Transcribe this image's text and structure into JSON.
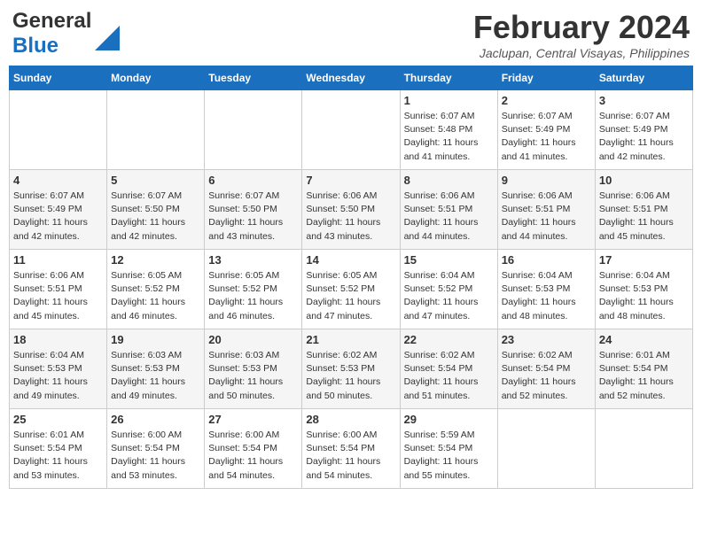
{
  "header": {
    "logo_general": "General",
    "logo_blue": "Blue",
    "month": "February 2024",
    "location": "Jaclupan, Central Visayas, Philippines"
  },
  "weekdays": [
    "Sunday",
    "Monday",
    "Tuesday",
    "Wednesday",
    "Thursday",
    "Friday",
    "Saturday"
  ],
  "weeks": [
    [
      {
        "day": "",
        "info": ""
      },
      {
        "day": "",
        "info": ""
      },
      {
        "day": "",
        "info": ""
      },
      {
        "day": "",
        "info": ""
      },
      {
        "day": "1",
        "info": "Sunrise: 6:07 AM\nSunset: 5:48 PM\nDaylight: 11 hours\nand 41 minutes."
      },
      {
        "day": "2",
        "info": "Sunrise: 6:07 AM\nSunset: 5:49 PM\nDaylight: 11 hours\nand 41 minutes."
      },
      {
        "day": "3",
        "info": "Sunrise: 6:07 AM\nSunset: 5:49 PM\nDaylight: 11 hours\nand 42 minutes."
      }
    ],
    [
      {
        "day": "4",
        "info": "Sunrise: 6:07 AM\nSunset: 5:49 PM\nDaylight: 11 hours\nand 42 minutes."
      },
      {
        "day": "5",
        "info": "Sunrise: 6:07 AM\nSunset: 5:50 PM\nDaylight: 11 hours\nand 42 minutes."
      },
      {
        "day": "6",
        "info": "Sunrise: 6:07 AM\nSunset: 5:50 PM\nDaylight: 11 hours\nand 43 minutes."
      },
      {
        "day": "7",
        "info": "Sunrise: 6:06 AM\nSunset: 5:50 PM\nDaylight: 11 hours\nand 43 minutes."
      },
      {
        "day": "8",
        "info": "Sunrise: 6:06 AM\nSunset: 5:51 PM\nDaylight: 11 hours\nand 44 minutes."
      },
      {
        "day": "9",
        "info": "Sunrise: 6:06 AM\nSunset: 5:51 PM\nDaylight: 11 hours\nand 44 minutes."
      },
      {
        "day": "10",
        "info": "Sunrise: 6:06 AM\nSunset: 5:51 PM\nDaylight: 11 hours\nand 45 minutes."
      }
    ],
    [
      {
        "day": "11",
        "info": "Sunrise: 6:06 AM\nSunset: 5:51 PM\nDaylight: 11 hours\nand 45 minutes."
      },
      {
        "day": "12",
        "info": "Sunrise: 6:05 AM\nSunset: 5:52 PM\nDaylight: 11 hours\nand 46 minutes."
      },
      {
        "day": "13",
        "info": "Sunrise: 6:05 AM\nSunset: 5:52 PM\nDaylight: 11 hours\nand 46 minutes."
      },
      {
        "day": "14",
        "info": "Sunrise: 6:05 AM\nSunset: 5:52 PM\nDaylight: 11 hours\nand 47 minutes."
      },
      {
        "day": "15",
        "info": "Sunrise: 6:04 AM\nSunset: 5:52 PM\nDaylight: 11 hours\nand 47 minutes."
      },
      {
        "day": "16",
        "info": "Sunrise: 6:04 AM\nSunset: 5:53 PM\nDaylight: 11 hours\nand 48 minutes."
      },
      {
        "day": "17",
        "info": "Sunrise: 6:04 AM\nSunset: 5:53 PM\nDaylight: 11 hours\nand 48 minutes."
      }
    ],
    [
      {
        "day": "18",
        "info": "Sunrise: 6:04 AM\nSunset: 5:53 PM\nDaylight: 11 hours\nand 49 minutes."
      },
      {
        "day": "19",
        "info": "Sunrise: 6:03 AM\nSunset: 5:53 PM\nDaylight: 11 hours\nand 49 minutes."
      },
      {
        "day": "20",
        "info": "Sunrise: 6:03 AM\nSunset: 5:53 PM\nDaylight: 11 hours\nand 50 minutes."
      },
      {
        "day": "21",
        "info": "Sunrise: 6:02 AM\nSunset: 5:53 PM\nDaylight: 11 hours\nand 50 minutes."
      },
      {
        "day": "22",
        "info": "Sunrise: 6:02 AM\nSunset: 5:54 PM\nDaylight: 11 hours\nand 51 minutes."
      },
      {
        "day": "23",
        "info": "Sunrise: 6:02 AM\nSunset: 5:54 PM\nDaylight: 11 hours\nand 52 minutes."
      },
      {
        "day": "24",
        "info": "Sunrise: 6:01 AM\nSunset: 5:54 PM\nDaylight: 11 hours\nand 52 minutes."
      }
    ],
    [
      {
        "day": "25",
        "info": "Sunrise: 6:01 AM\nSunset: 5:54 PM\nDaylight: 11 hours\nand 53 minutes."
      },
      {
        "day": "26",
        "info": "Sunrise: 6:00 AM\nSunset: 5:54 PM\nDaylight: 11 hours\nand 53 minutes."
      },
      {
        "day": "27",
        "info": "Sunrise: 6:00 AM\nSunset: 5:54 PM\nDaylight: 11 hours\nand 54 minutes."
      },
      {
        "day": "28",
        "info": "Sunrise: 6:00 AM\nSunset: 5:54 PM\nDaylight: 11 hours\nand 54 minutes."
      },
      {
        "day": "29",
        "info": "Sunrise: 5:59 AM\nSunset: 5:54 PM\nDaylight: 11 hours\nand 55 minutes."
      },
      {
        "day": "",
        "info": ""
      },
      {
        "day": "",
        "info": ""
      }
    ]
  ]
}
